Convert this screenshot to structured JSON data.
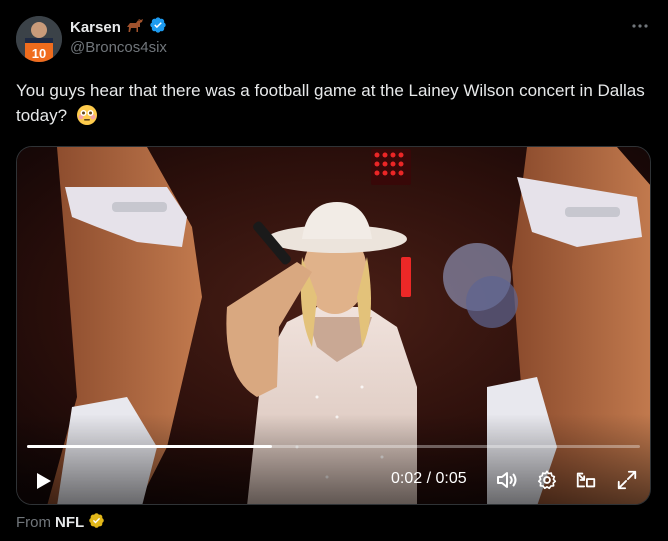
{
  "author": {
    "display_name": "Karsen",
    "name_emoji_icon": "horse-icon",
    "verified_icon": "blue-verified-badge-icon",
    "handle": "@Broncos4six",
    "avatar_jersey_number": "10",
    "avatar_colors": {
      "jersey": "#f06c1d",
      "number": "#ffffff"
    }
  },
  "more_icon": "ellipsis-icon",
  "tweet": {
    "text": "You guys hear that there was a football game at the Lainey Wilson concert in Dallas today?",
    "emoji_icon": "flushed-face-icon"
  },
  "video": {
    "progress": 0.4,
    "current_time": "0:02",
    "duration": "0:05",
    "time_separator": " / ",
    "time_display": "0:02 / 0:05",
    "icons": {
      "play": "play-icon",
      "volume": "volume-icon",
      "settings": "gear-icon",
      "pip": "picture-in-picture-icon",
      "fullscreen": "fullscreen-icon"
    }
  },
  "source": {
    "prefix": "From",
    "name": "NFL",
    "badge_icon": "gold-verified-badge-icon"
  },
  "colors": {
    "background": "#000000",
    "text_primary": "#e7e9ea",
    "text_secondary": "#71767b",
    "verified_blue": "#1d9bf0",
    "verified_gold": "#e2b719"
  }
}
